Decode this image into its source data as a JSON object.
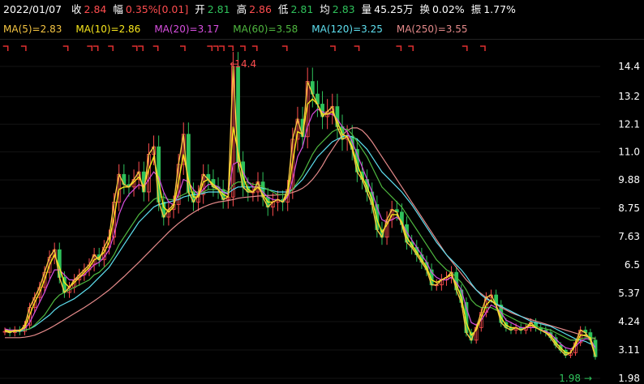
{
  "header": {
    "date": "2022/01/07",
    "fields": [
      {
        "label": "收",
        "value": "2.84",
        "color": "#ff4d4f"
      },
      {
        "label": "幅",
        "value": "0.35%[0.01]",
        "color": "#ff4d4f"
      },
      {
        "label": "开",
        "value": "2.81",
        "color": "#2fc25b"
      },
      {
        "label": "高",
        "value": "2.86",
        "color": "#ff4d4f"
      },
      {
        "label": "低",
        "value": "2.81",
        "color": "#2fc25b"
      },
      {
        "label": "均",
        "value": "2.83",
        "color": "#2fc25b"
      },
      {
        "label": "量",
        "value": "45.25万",
        "color": "#ffffff"
      },
      {
        "label": "换",
        "value": "0.02%",
        "color": "#ffffff"
      },
      {
        "label": "振",
        "value": "1.77%",
        "color": "#ffffff"
      }
    ]
  },
  "ma_legend": [
    {
      "text": "MA(5)=2.83",
      "color": "#f5c542"
    },
    {
      "text": "MA(10)=2.86",
      "color": "#f8e71c"
    },
    {
      "text": "MA(20)=3.17",
      "color": "#d94fe0"
    },
    {
      "text": "MA(60)=3.58",
      "color": "#4fb83f"
    },
    {
      "text": "MA(120)=3.25",
      "color": "#5ee0f0"
    },
    {
      "text": "MA(250)=3.55",
      "color": "#e58a8a"
    }
  ],
  "chart_data": {
    "type": "line",
    "ylabel": "",
    "xlabel": "",
    "yticks": [
      "14.4",
      "13.2",
      "12.1",
      "11.0",
      "9.88",
      "8.75",
      "7.63",
      "6.5",
      "5.37",
      "4.24",
      "3.11",
      "1.98"
    ],
    "ylim": [
      1.98,
      14.4
    ],
    "annotations": {
      "high": "14.4",
      "low": "1.98"
    },
    "candle_color": "#ff4d4f",
    "candle_down_color": "#2fc25b",
    "event_marker_color": "#e03030",
    "event_markers": [
      0.005,
      0.035,
      0.105,
      0.145,
      0.155,
      0.18,
      0.22,
      0.23,
      0.255,
      0.3,
      0.345,
      0.355,
      0.365,
      0.38,
      0.4,
      0.42,
      0.47,
      0.55,
      0.59,
      0.66,
      0.68,
      0.77,
      0.8
    ],
    "x_count": 120,
    "series": [
      {
        "name": "MA(5)",
        "color": "#f5c542",
        "values": [
          3.85,
          3.8,
          3.9,
          3.85,
          4.1,
          4.8,
          5.2,
          5.6,
          6.2,
          6.8,
          7.1,
          6.0,
          5.4,
          5.6,
          5.9,
          6.1,
          6.3,
          6.5,
          6.9,
          6.7,
          7.2,
          7.6,
          9.0,
          10.1,
          9.7,
          9.6,
          9.9,
          10.2,
          9.4,
          10.9,
          11.2,
          9.0,
          8.4,
          8.7,
          8.9,
          10.5,
          11.7,
          9.4,
          9.0,
          9.3,
          10.1,
          9.9,
          9.6,
          9.5,
          9.1,
          9.2,
          14.4,
          10.6,
          9.6,
          9.4,
          9.4,
          9.8,
          9.2,
          8.8,
          9.0,
          9.1,
          9.0,
          9.5,
          11.5,
          12.3,
          11.6,
          13.8,
          13.3,
          12.9,
          12.4,
          12.6,
          12.8,
          12.0,
          11.5,
          11.6,
          11.1,
          10.2,
          9.9,
          9.4,
          8.9,
          7.9,
          7.6,
          8.3,
          8.7,
          8.6,
          8.1,
          7.4,
          7.2,
          6.9,
          6.6,
          6.3,
          5.7,
          5.7,
          5.9,
          6.0,
          6.2,
          5.5,
          5.0,
          3.8,
          3.5,
          4.0,
          4.6,
          5.2,
          5.3,
          4.9,
          4.2,
          4.0,
          3.9,
          4.0,
          3.9,
          4.0,
          4.2,
          4.0,
          3.9,
          3.8,
          3.6,
          3.3,
          3.1,
          2.9,
          3.0,
          3.4,
          3.9,
          3.8,
          3.5,
          2.84
        ]
      },
      {
        "name": "MA(10)",
        "color": "#f8e71c",
        "values": [
          3.9,
          3.85,
          3.85,
          3.9,
          4.0,
          4.5,
          5.0,
          5.4,
          5.9,
          6.5,
          6.9,
          6.4,
          5.8,
          5.6,
          5.8,
          6.0,
          6.2,
          6.4,
          6.7,
          6.8,
          7.0,
          7.4,
          8.4,
          9.5,
          9.6,
          9.6,
          9.8,
          10.0,
          9.6,
          10.3,
          10.8,
          9.8,
          8.8,
          8.6,
          8.8,
          9.8,
          10.9,
          9.9,
          9.2,
          9.2,
          9.8,
          9.9,
          9.7,
          9.5,
          9.3,
          9.2,
          12.0,
          11.0,
          10.0,
          9.5,
          9.4,
          9.6,
          9.3,
          9.0,
          9.0,
          9.1,
          9.0,
          9.3,
          10.6,
          11.8,
          11.7,
          12.9,
          13.1,
          12.9,
          12.5,
          12.5,
          12.6,
          12.2,
          11.7,
          11.6,
          11.2,
          10.5,
          10.0,
          9.6,
          9.1,
          8.3,
          7.8,
          8.1,
          8.5,
          8.5,
          8.2,
          7.6,
          7.3,
          7.0,
          6.7,
          6.4,
          5.9,
          5.8,
          5.9,
          6.0,
          6.1,
          5.7,
          5.2,
          4.2,
          3.7,
          3.9,
          4.4,
          4.9,
          5.1,
          4.9,
          4.4,
          4.1,
          4.0,
          4.0,
          3.9,
          4.0,
          4.1,
          4.0,
          3.9,
          3.8,
          3.7,
          3.4,
          3.2,
          3.0,
          3.0,
          3.3,
          3.7,
          3.7,
          3.6,
          2.86
        ]
      },
      {
        "name": "MA(20)",
        "color": "#d94fe0",
        "values": [
          3.95,
          3.9,
          3.9,
          3.9,
          3.95,
          4.2,
          4.6,
          5.0,
          5.4,
          5.9,
          6.3,
          6.3,
          6.1,
          5.9,
          5.9,
          6.0,
          6.1,
          6.3,
          6.5,
          6.6,
          6.8,
          7.1,
          7.7,
          8.5,
          9.0,
          9.3,
          9.5,
          9.7,
          9.6,
          9.9,
          10.2,
          10.0,
          9.4,
          9.0,
          8.9,
          9.3,
          9.9,
          9.8,
          9.5,
          9.3,
          9.5,
          9.7,
          9.7,
          9.6,
          9.4,
          9.3,
          10.5,
          10.6,
          10.2,
          9.8,
          9.6,
          9.6,
          9.4,
          9.2,
          9.1,
          9.1,
          9.0,
          9.2,
          9.9,
          10.8,
          11.2,
          12.0,
          12.5,
          12.7,
          12.6,
          12.5,
          12.5,
          12.3,
          12.0,
          11.8,
          11.4,
          10.9,
          10.4,
          9.9,
          9.4,
          8.8,
          8.3,
          8.2,
          8.3,
          8.4,
          8.2,
          7.8,
          7.5,
          7.2,
          6.9,
          6.6,
          6.2,
          6.0,
          5.9,
          5.9,
          6.0,
          5.8,
          5.5,
          4.8,
          4.2,
          4.1,
          4.3,
          4.6,
          4.9,
          4.8,
          4.6,
          4.3,
          4.2,
          4.1,
          4.0,
          4.0,
          4.0,
          4.0,
          3.9,
          3.85,
          3.75,
          3.55,
          3.35,
          3.2,
          3.15,
          3.25,
          3.45,
          3.55,
          3.55,
          3.17
        ]
      },
      {
        "name": "MA(60)",
        "color": "#4fb83f",
        "values": [
          3.9,
          3.9,
          3.9,
          3.9,
          3.9,
          3.95,
          4.1,
          4.3,
          4.5,
          4.8,
          5.1,
          5.3,
          5.4,
          5.5,
          5.6,
          5.7,
          5.8,
          5.9,
          6.1,
          6.2,
          6.4,
          6.6,
          6.9,
          7.3,
          7.6,
          7.9,
          8.2,
          8.5,
          8.7,
          8.9,
          9.1,
          9.2,
          9.2,
          9.1,
          9.1,
          9.2,
          9.3,
          9.4,
          9.4,
          9.4,
          9.4,
          9.5,
          9.5,
          9.5,
          9.5,
          9.4,
          9.7,
          9.8,
          9.8,
          9.8,
          9.7,
          9.7,
          9.6,
          9.5,
          9.4,
          9.3,
          9.3,
          9.3,
          9.5,
          9.8,
          10.1,
          10.5,
          10.9,
          11.2,
          11.4,
          11.6,
          11.8,
          11.9,
          11.9,
          11.9,
          11.7,
          11.4,
          11.1,
          10.8,
          10.4,
          10.0,
          9.6,
          9.4,
          9.2,
          9.0,
          8.8,
          8.5,
          8.2,
          7.9,
          7.6,
          7.3,
          7.0,
          6.7,
          6.5,
          6.3,
          6.2,
          6.0,
          5.8,
          5.5,
          5.1,
          4.9,
          4.8,
          4.8,
          4.8,
          4.7,
          4.6,
          4.5,
          4.4,
          4.3,
          4.2,
          4.15,
          4.1,
          4.05,
          4.0,
          3.95,
          3.9,
          3.8,
          3.7,
          3.6,
          3.5,
          3.5,
          3.55,
          3.6,
          3.6,
          3.58
        ]
      },
      {
        "name": "MA(120)",
        "color": "#5ee0f0",
        "values": [
          3.85,
          3.85,
          3.85,
          3.85,
          3.9,
          3.95,
          4.05,
          4.2,
          4.35,
          4.5,
          4.7,
          4.85,
          4.95,
          5.05,
          5.15,
          5.3,
          5.45,
          5.6,
          5.8,
          6.0,
          6.2,
          6.4,
          6.7,
          7.0,
          7.3,
          7.6,
          7.9,
          8.2,
          8.4,
          8.6,
          8.8,
          8.9,
          8.95,
          9.0,
          9.05,
          9.1,
          9.2,
          9.25,
          9.3,
          9.3,
          9.35,
          9.4,
          9.4,
          9.4,
          9.4,
          9.35,
          9.5,
          9.6,
          9.6,
          9.6,
          9.6,
          9.6,
          9.55,
          9.5,
          9.45,
          9.4,
          9.4,
          9.4,
          9.5,
          9.7,
          9.9,
          10.2,
          10.5,
          10.8,
          11.0,
          11.2,
          11.4,
          11.5,
          11.6,
          11.65,
          11.6,
          11.5,
          11.3,
          11.1,
          10.8,
          10.5,
          10.2,
          10.0,
          9.8,
          9.6,
          9.4,
          9.15,
          8.9,
          8.6,
          8.3,
          8.0,
          7.7,
          7.4,
          7.15,
          6.9,
          6.7,
          6.5,
          6.3,
          6.05,
          5.75,
          5.5,
          5.3,
          5.15,
          5.05,
          4.95,
          4.85,
          4.75,
          4.65,
          4.55,
          4.45,
          4.35,
          4.25,
          4.2,
          4.15,
          4.1,
          4.05,
          3.95,
          3.85,
          3.75,
          3.65,
          3.55,
          3.5,
          3.45,
          3.35,
          3.25
        ]
      },
      {
        "name": "MA(250)",
        "color": "#e58a8a",
        "values": [
          3.6,
          3.6,
          3.6,
          3.6,
          3.62,
          3.65,
          3.7,
          3.78,
          3.87,
          3.97,
          4.08,
          4.2,
          4.32,
          4.44,
          4.56,
          4.68,
          4.8,
          4.93,
          5.06,
          5.2,
          5.35,
          5.5,
          5.67,
          5.85,
          6.03,
          6.22,
          6.41,
          6.6,
          6.8,
          7.0,
          7.2,
          7.4,
          7.6,
          7.8,
          7.98,
          8.15,
          8.3,
          8.45,
          8.58,
          8.7,
          8.8,
          8.88,
          8.95,
          9.0,
          9.03,
          9.06,
          9.1,
          9.15,
          9.18,
          9.2,
          9.22,
          9.24,
          9.25,
          9.26,
          9.27,
          9.28,
          9.3,
          9.33,
          9.38,
          9.45,
          9.55,
          9.7,
          9.9,
          10.15,
          10.45,
          10.8,
          11.1,
          11.4,
          11.65,
          11.85,
          11.95,
          11.95,
          11.85,
          11.65,
          11.4,
          11.1,
          10.8,
          10.5,
          10.2,
          9.9,
          9.6,
          9.3,
          9.0,
          8.7,
          8.4,
          8.1,
          7.8,
          7.5,
          7.2,
          6.9,
          6.65,
          6.4,
          6.15,
          5.9,
          5.7,
          5.5,
          5.35,
          5.2,
          5.05,
          4.92,
          4.8,
          4.7,
          4.6,
          4.52,
          4.45,
          4.38,
          4.32,
          4.26,
          4.2,
          4.14,
          4.08,
          4.02,
          3.96,
          3.9,
          3.84,
          3.78,
          3.72,
          3.66,
          3.6,
          3.55
        ]
      }
    ]
  }
}
